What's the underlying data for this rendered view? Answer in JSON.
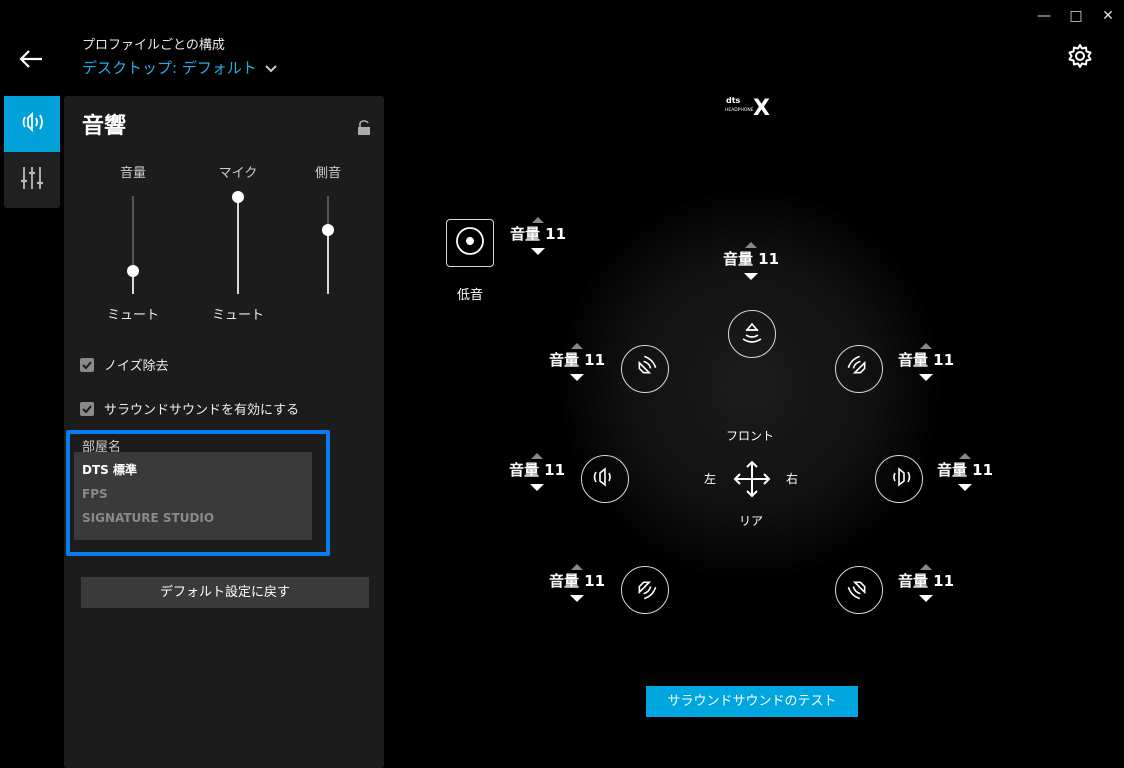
{
  "window": {
    "minimize": "—",
    "maximize": "□",
    "close": "✕"
  },
  "header": {
    "subtitle": "プロファイルごとの構成",
    "profile": "デスクトップ: デフォルト"
  },
  "panel": {
    "title": "音響",
    "sliders": [
      {
        "label": "音量",
        "bottom": "ミュート",
        "level": 0.2
      },
      {
        "label": "マイク",
        "bottom": "ミュート",
        "level": 1.0
      },
      {
        "label": "側音",
        "bottom": "",
        "level": 0.66
      }
    ],
    "noise_reduction": "ノイズ除去",
    "surround_enable": "サラウンドサウンドを有効にする",
    "room_label": "部屋名",
    "rooms": [
      "DTS 標準",
      "FPS",
      "SIGNATURE STUDIO"
    ],
    "reset": "デフォルト設定に戻す"
  },
  "surround": {
    "bass_label": "低音",
    "front_label": "フロント",
    "rear_label": "リア",
    "left_label": "左",
    "right_label": "右",
    "volumes": {
      "bass": "音量 11",
      "center": "音量 11",
      "front_left": "音量 11",
      "front_right": "音量 11",
      "left": "音量 11",
      "right": "音量 11",
      "rear_left": "音量 11",
      "rear_right": "音量 11"
    },
    "test_button": "サラウンドサウンドのテスト"
  },
  "logo": {
    "line1": "dts",
    "line2": "HEADPHONE",
    "mark": "X"
  },
  "colors": {
    "accent": "#00a0d8",
    "highlight": "#0b7cf0",
    "panel": "#1c1c1c"
  }
}
